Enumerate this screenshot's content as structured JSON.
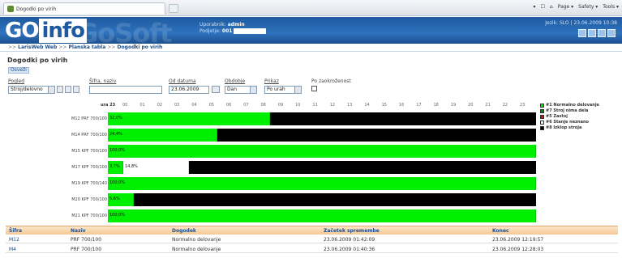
{
  "browser": {
    "tab_title": "Dogodki po virih",
    "tools": [
      "▾",
      "☐",
      "⌂",
      "Page ▾",
      "Safety ▾",
      "Tools ▾"
    ]
  },
  "header": {
    "logo_prefix": "GO",
    "logo_suffix": "info",
    "watermark": "GoSoft",
    "user_label": "Uporabnik:",
    "user_value": "admin",
    "filter_label": "Podjetje:",
    "filter_value": "001",
    "right_text": "Jezik: SLO  |  23.06.2009 10:38"
  },
  "breadcrumb": {
    "sep": ">>",
    "items": [
      "LarisWeb Web",
      "Planska tabla",
      "Dogodki po virih"
    ]
  },
  "page": {
    "title": "Dogodki po virih",
    "refresh": "Osveži"
  },
  "filters": {
    "group_label": "Pogled",
    "group_value": "Stroj/delovno",
    "search_label": "Šifra, naziv",
    "search_value": "",
    "date_label": "Od datuma",
    "date_value": "23.06.2009",
    "period_label": "Obdobje",
    "period_value": "Dan",
    "sort_label": "Prikaz",
    "sort_value": "Po urah",
    "checkbox_label": "Po zaokroženost"
  },
  "chart_data": {
    "type": "timeline",
    "hours": [
      "ura 23",
      "00",
      "01",
      "02",
      "03",
      "04",
      "05",
      "06",
      "07",
      "08",
      "09",
      "10",
      "11",
      "12",
      "13",
      "14",
      "15",
      "16",
      "17",
      "18",
      "19",
      "20",
      "21",
      "22",
      "23"
    ],
    "rows": [
      {
        "label": "M12 PRF 700/100",
        "segments": [
          {
            "status": "running",
            "start": 0,
            "end": 0.378,
            "label": "32,0%"
          },
          {
            "status": "stopped",
            "start": 0.378,
            "end": 1
          }
        ]
      },
      {
        "label": "M14 PRF 700/100",
        "segments": [
          {
            "status": "running",
            "start": 0,
            "end": 0.256,
            "label": "24,4%"
          },
          {
            "status": "stopped",
            "start": 0.256,
            "end": 1
          }
        ]
      },
      {
        "label": "M15 KPF 700/100",
        "segments": [
          {
            "status": "running",
            "start": 0,
            "end": 1,
            "label": "100,0%"
          }
        ]
      },
      {
        "label": "M17 KPF 700/100",
        "segments": [
          {
            "status": "running",
            "start": 0,
            "end": 0.036,
            "label": "3,7%"
          },
          {
            "status": "idle",
            "start": 0.036,
            "end": 0.19,
            "label": "14,8%"
          },
          {
            "status": "stopped",
            "start": 0.19,
            "end": 1
          }
        ]
      },
      {
        "label": "M19 KPF 700/140",
        "segments": [
          {
            "status": "running",
            "start": 0,
            "end": 1,
            "label": "100,0%"
          }
        ]
      },
      {
        "label": "M20 KPF 700/100",
        "segments": [
          {
            "status": "running",
            "start": 0,
            "end": 0.06,
            "label": "5,6%"
          },
          {
            "status": "stopped",
            "start": 0.06,
            "end": 1
          }
        ]
      },
      {
        "label": "M21 KPF 700/100",
        "segments": [
          {
            "status": "running",
            "start": 0,
            "end": 1,
            "label": "100,0%"
          }
        ]
      }
    ],
    "legend": [
      {
        "key": "running",
        "name": "#1 Normalno delovanje",
        "color": "#00ee00"
      },
      {
        "key": "idle2",
        "name": "#7 Stroj nima dela",
        "color": "#008800"
      },
      {
        "key": "fault",
        "name": "#5 Zastoj",
        "color": "#dd0000"
      },
      {
        "key": "idle",
        "name": "#6 Stanje neznano",
        "color": "#ffffff"
      },
      {
        "key": "stopped",
        "name": "#8 Izklop stroja",
        "color": "#000000"
      }
    ]
  },
  "table": {
    "headers": [
      "Šifra",
      "Naziv",
      "Dogodek",
      "Začetek spremembe",
      "Konec"
    ],
    "rows": [
      [
        "M12",
        "PRF 700/100",
        "Normalno delovanje",
        "23.06.2009 01:42:09",
        "23.06.2009 12:19:57"
      ],
      [
        "M4",
        "PRF 700/100",
        "Normalno delovanje",
        "23.06.2009 01:40:36",
        "23.06.2009 12:28:03"
      ]
    ]
  }
}
